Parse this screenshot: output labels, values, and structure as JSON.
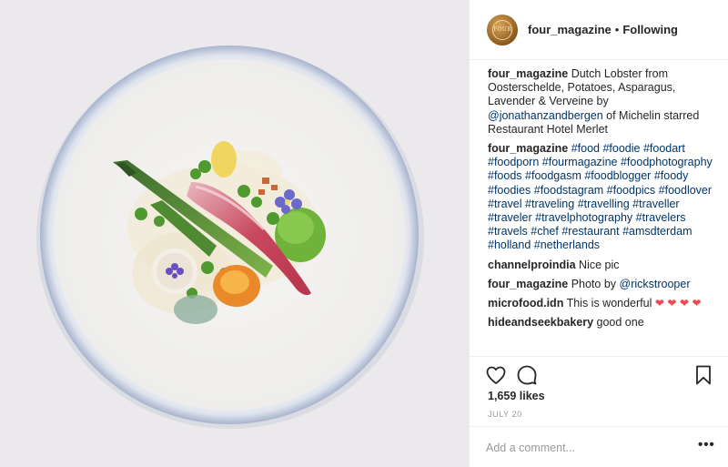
{
  "post": {
    "image_alt_subject": "plated dish on white ceramic plate"
  },
  "header": {
    "username": "four_magazine",
    "separator": "•",
    "follow_state": "Following",
    "avatar_text": "FOUR"
  },
  "caption": {
    "username": "four_magazine",
    "text_before": " Dutch Lobster from Oosterschelde, Potatoes, Asparagus, Lavender & Verveine by ",
    "mention": "@jonathanzandbergen",
    "text_after": " of Michelin starred Restaurant Hotel Merlet"
  },
  "comments": [
    {
      "username": "four_magazine",
      "hashtags": [
        "#food",
        "#foodie",
        "#foodart",
        "#foodporn",
        "#fourmagazine",
        "#foodphotography",
        "#foods",
        "#foodgasm",
        "#foodblogger",
        "#foody",
        "#foodies",
        "#foodstagram",
        "#foodpics",
        "#foodlover",
        "#travel",
        "#traveling",
        "#travelling",
        "#traveller",
        "#traveler",
        "#travelphotography",
        "#travelers",
        "#travels",
        "#chef",
        "#restaurant",
        "#amsdterdam",
        "#holland",
        "#netherlands"
      ]
    },
    {
      "username": "channelproindia",
      "text": " Nice pic"
    },
    {
      "username": "four_magazine",
      "text": " Photo by ",
      "mention": "@rickstrooper"
    },
    {
      "username": "microfood.idn",
      "text": " This is wonderful ",
      "hearts": [
        "❤",
        "❤",
        "❤",
        "❤"
      ]
    },
    {
      "username": "hideandseekbakery",
      "text": " good one"
    }
  ],
  "actions": {
    "like_icon": "heart-outline-icon",
    "comment_icon": "speech-bubble-icon",
    "save_icon": "bookmark-icon"
  },
  "likes_text": "1,659 likes",
  "date_text": "JULY 20",
  "add_comment": {
    "placeholder": "Add a comment...",
    "more_label": "•••"
  },
  "colors": {
    "link": "#003569",
    "heart": "#ed4956",
    "border": "#efefef",
    "muted": "#999999"
  }
}
